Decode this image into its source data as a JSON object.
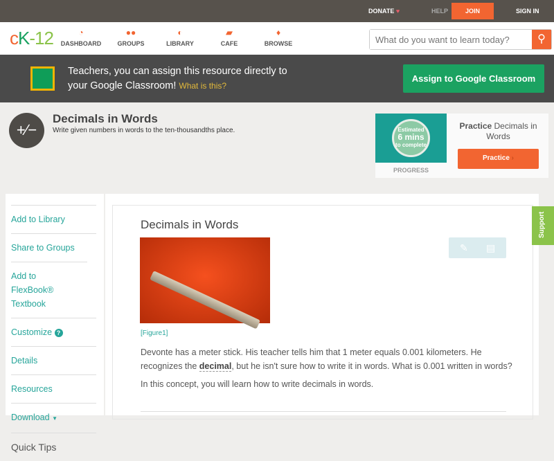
{
  "topbar": {
    "donate": "DONATE",
    "help": "HELP",
    "join": "JOIN",
    "signin": "SIGN IN"
  },
  "nav": {
    "logo": {
      "c": "c",
      "k": "K",
      "rest": "-12"
    },
    "items": [
      {
        "label": "DASHBOARD",
        "icon": "dashboard-icon"
      },
      {
        "label": "GROUPS",
        "icon": "groups-icon"
      },
      {
        "label": "LIBRARY",
        "icon": "library-icon"
      },
      {
        "label": "CAFE",
        "icon": "cafe-icon"
      },
      {
        "label": "BROWSE",
        "icon": "browse-icon"
      }
    ],
    "search_placeholder": "What do you want to learn today?"
  },
  "banner": {
    "text1": "Teachers, you can assign this resource directly to",
    "text2": "your Google Classroom!",
    "link": "What is this?",
    "button": "Assign to Google Classroom"
  },
  "header": {
    "title": "Decimals in Words",
    "subtitle": "Write given numbers in words to the ten-thousandths place."
  },
  "practice": {
    "estimated": "Estimated",
    "mins": "6 mins",
    "complete": "to complete",
    "progress": "PROGRESS",
    "title_bold": "Practice",
    "title_rest": "Decimals in Words",
    "button": "Practice"
  },
  "sidebar": {
    "items": [
      "Add to Library",
      "Share to Groups",
      "Add to FlexBook® Textbook",
      "Customize",
      "Details",
      "Resources",
      "Download"
    ],
    "quick_tips": "Quick Tips"
  },
  "content": {
    "title": "Decimals in Words",
    "figure": "[Figure1]",
    "p1a": "Devonte has a meter stick. His teacher tells him that 1 meter equals 0.001 kilometers. He recognizes the ",
    "p1b": "decimal",
    "p1c": ", but he isn't sure how to write it in words. What is 0.001 written in words?",
    "p2": "In this concept, you will learn how to write decimals in words."
  },
  "support": "Support",
  "colors": {
    "accent": "#f26531",
    "teal": "#26a59a",
    "green": "#1ba261"
  }
}
